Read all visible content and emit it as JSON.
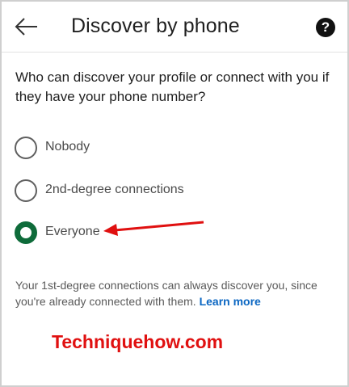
{
  "header": {
    "back_icon": "arrow-left-icon",
    "title": "Discover by phone",
    "help_icon": "question-circle-icon",
    "help_glyph": "?"
  },
  "main": {
    "question": "Who can discover your profile or connect with you if they have your phone number?",
    "options": [
      {
        "label": "Nobody",
        "selected": false
      },
      {
        "label": "2nd-degree connections",
        "selected": false
      },
      {
        "label": "Everyone",
        "selected": true
      }
    ],
    "footnote": "Your 1st-degree connections can always discover you, since you're already connected with them.",
    "learn_more": "Learn more"
  },
  "watermark": "Techniquehow.com",
  "colors": {
    "accent_green": "#0e6b3a",
    "link_blue": "#0a66c2",
    "annotation_red": "#e01010"
  }
}
